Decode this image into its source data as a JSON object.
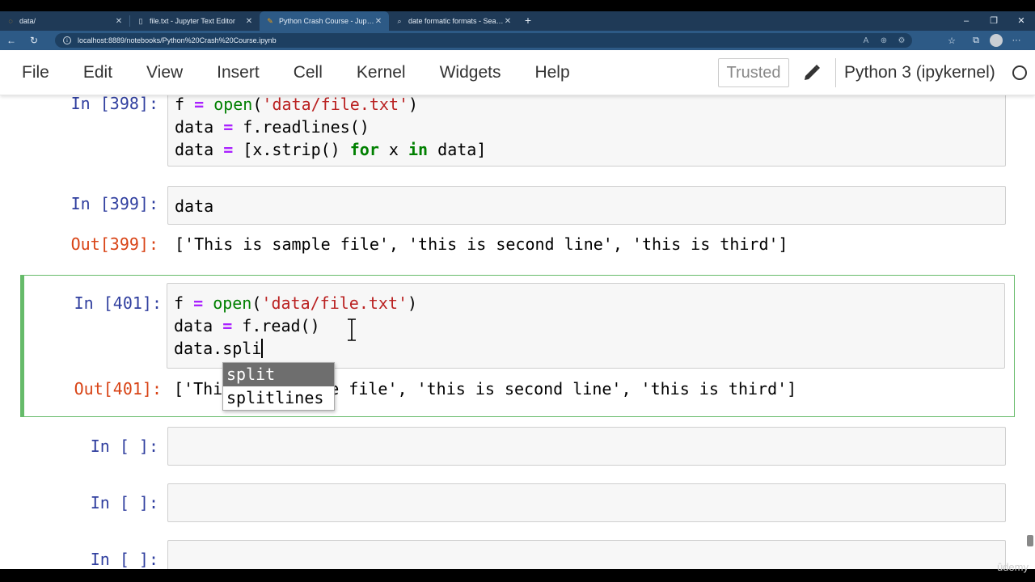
{
  "browser": {
    "tabs": [
      {
        "title": "data/",
        "active": false
      },
      {
        "title": "file.txt - Jupyter Text Editor",
        "active": false
      },
      {
        "title": "Python Crash Course - Jupyter N",
        "active": true
      },
      {
        "title": "date formatic formats - Search",
        "active": false
      }
    ],
    "url": "localhost:8889/notebooks/Python%20Crash%20Course.ipynb"
  },
  "menu": {
    "items": [
      "File",
      "Edit",
      "View",
      "Insert",
      "Cell",
      "Kernel",
      "Widgets",
      "Help"
    ],
    "trusted": "Trusted",
    "kernel": "Python 3 (ipykernel)"
  },
  "cells": [
    {
      "in_prompt": "In [398]:",
      "lines": [
        "f = open('data/file.txt')",
        "data = f.readlines()",
        "data = [x.strip() for x in data]"
      ]
    },
    {
      "in_prompt": "In [399]:",
      "lines": [
        "data"
      ],
      "out_prompt": "Out[399]:",
      "output": "['This is sample file', 'this is second line', 'this is third']"
    },
    {
      "in_prompt": "In [401]:",
      "lines": [
        "f = open('data/file.txt')",
        "data = f.read()",
        "data.spli"
      ],
      "out_prompt": "Out[401]:",
      "output_prefix": "['Thi",
      "output_suffix": "e file', 'this is second line', 'this is third']"
    },
    {
      "in_prompt": "In [ ]:"
    },
    {
      "in_prompt": "In [ ]:"
    },
    {
      "in_prompt": "In [ ]:"
    }
  ],
  "completer": {
    "options": [
      "split",
      "splitlines"
    ],
    "selected": "split"
  },
  "watermark": "ûdemy"
}
